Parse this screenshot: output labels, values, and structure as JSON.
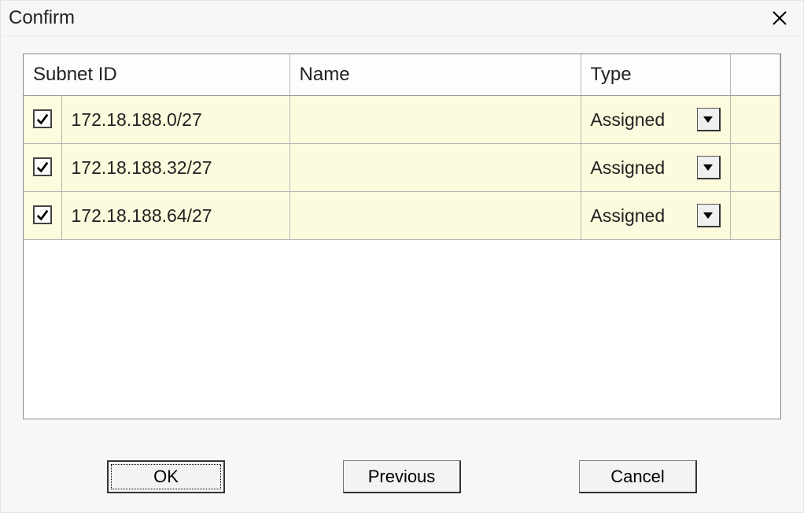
{
  "window": {
    "title": "Confirm"
  },
  "columns": {
    "subnet": "Subnet ID",
    "name": "Name",
    "type": "Type"
  },
  "rows": [
    {
      "checked": true,
      "subnet": "172.18.188.0/27",
      "name": "",
      "type": "Assigned"
    },
    {
      "checked": true,
      "subnet": "172.18.188.32/27",
      "name": "",
      "type": "Assigned"
    },
    {
      "checked": true,
      "subnet": "172.18.188.64/27",
      "name": "",
      "type": "Assigned"
    }
  ],
  "buttons": {
    "ok": "OK",
    "previous": "Previous",
    "cancel": "Cancel"
  }
}
